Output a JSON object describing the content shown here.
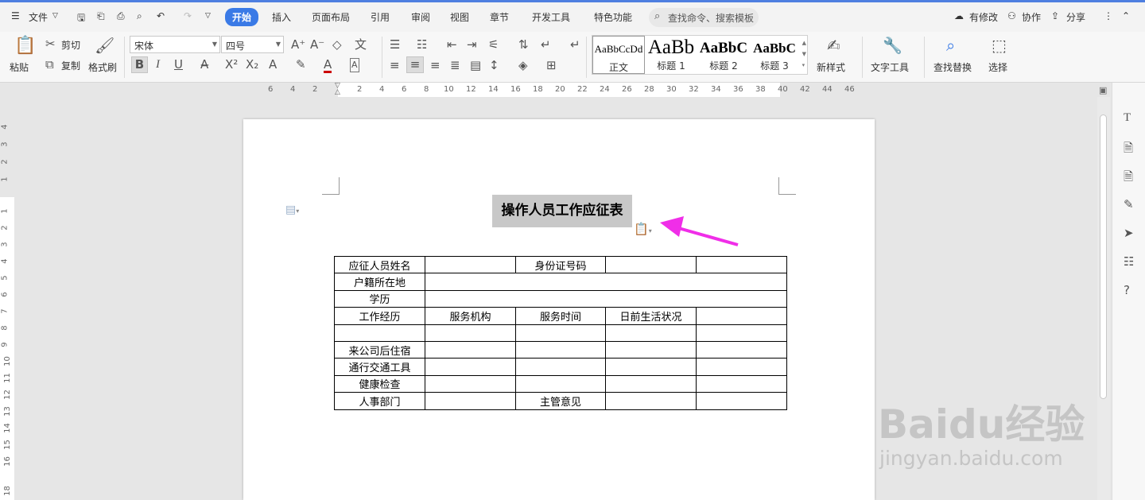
{
  "menubar": {
    "file_label": "文件",
    "tabs": [
      "开始",
      "插入",
      "页面布局",
      "引用",
      "审阅",
      "视图",
      "章节",
      "开发工具",
      "特色功能"
    ],
    "search_placeholder": "查找命令、搜索模板",
    "right": {
      "modify": "有修改",
      "collab": "协作",
      "share": "分享"
    }
  },
  "ribbon": {
    "paste": "粘贴",
    "cut": "剪切",
    "copy": "复制",
    "format_painter": "格式刷",
    "font_name": "宋体",
    "font_size": "四号",
    "styles": [
      {
        "sample": "AaBbCcDd",
        "label": "正文"
      },
      {
        "sample": "AaBb",
        "label": "标题 1"
      },
      {
        "sample": "AaBbC",
        "label": "标题 2"
      },
      {
        "sample": "AaBbC",
        "label": "标题 3"
      }
    ],
    "new_style": "新样式",
    "text_tools": "文字工具",
    "find_replace": "查找替换",
    "select": "选择"
  },
  "ruler": {
    "h": [
      "6",
      "4",
      "2",
      "2",
      "4",
      "6",
      "8",
      "10",
      "12",
      "14",
      "16",
      "18",
      "20",
      "22",
      "24",
      "26",
      "28",
      "30",
      "32",
      "34",
      "36",
      "38",
      "40",
      "42",
      "44",
      "46"
    ],
    "v": [
      "4",
      "3",
      "2",
      "1",
      "1",
      "2",
      "3",
      "4",
      "5",
      "6",
      "7",
      "8",
      "9",
      "10",
      "11",
      "12",
      "13",
      "14",
      "15",
      "16",
      "18"
    ]
  },
  "document": {
    "title": "操作人员工作应征表",
    "table": [
      [
        "应征人员姓名",
        "",
        "身份证号码",
        "",
        ""
      ],
      [
        "户籍所在地",
        ""
      ],
      [
        "学历",
        ""
      ],
      [
        "工作经历",
        "服务机构",
        "服务时间",
        "日前生活状况",
        ""
      ],
      [
        "",
        "",
        "",
        "",
        ""
      ],
      [
        "来公司后住宿",
        "",
        "",
        "",
        ""
      ],
      [
        "通行交通工具",
        "",
        "",
        "",
        ""
      ],
      [
        "健康检查",
        "",
        "",
        "",
        ""
      ],
      [
        "人事部门",
        "",
        "主管意见",
        "",
        ""
      ]
    ]
  },
  "watermark": {
    "brand": "Baidu经验",
    "url": "jingyan.baidu.com"
  },
  "colors": {
    "accent": "#3a7ae6",
    "arrow": "#f02ee8",
    "selection": "#c8c8c8"
  }
}
